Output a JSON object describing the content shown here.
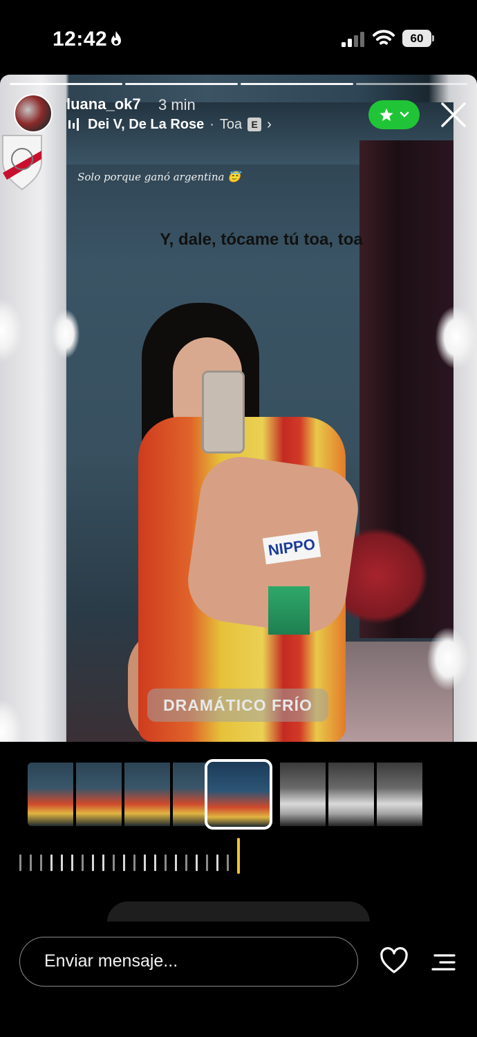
{
  "status_bar": {
    "time": "12:42",
    "battery": "60",
    "icons": [
      "flame-icon",
      "signal-icon",
      "wifi-icon",
      "battery-icon"
    ]
  },
  "story": {
    "segments_total": 4,
    "segments_done": 3,
    "username": "luana_ok7",
    "time_ago": "3 min",
    "music": {
      "artist": "Dei V, De La Rose",
      "separator": "·",
      "song": "Toa",
      "explicit_label": "E"
    },
    "caption": "Solo porque ganó argentina 😇",
    "lyrics": "Y, dale, tócame tú toa, toa",
    "filter_name": "DRAMÁTICO FRÍO",
    "nippo_logo": "NIPPO",
    "close_label": "✕",
    "colors": {
      "close_friends_green": "#20c537",
      "playhead_yellow": "#f0c62a"
    }
  },
  "editor": {
    "filmstrip_frames": 8,
    "selected_frame": 4
  },
  "reply": {
    "placeholder": "Enviar mensaje..."
  }
}
